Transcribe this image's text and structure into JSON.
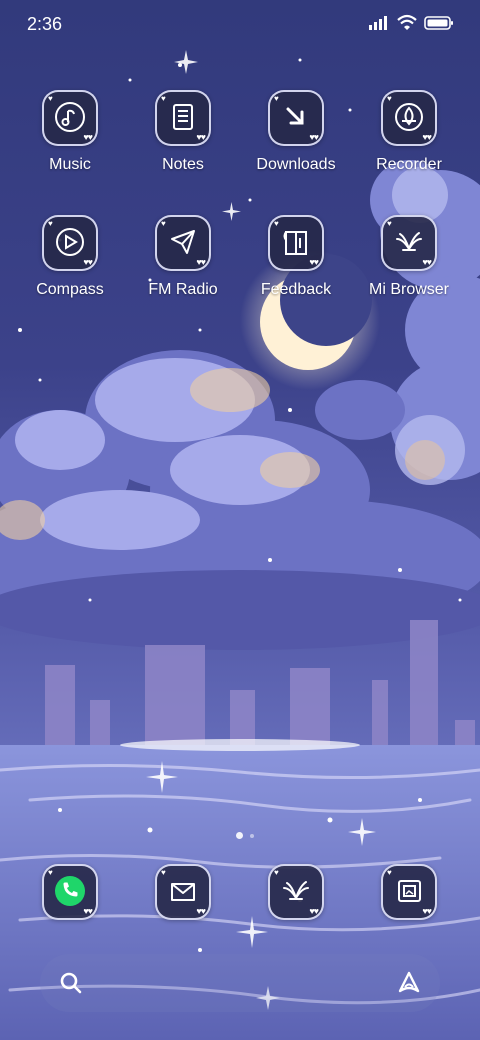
{
  "status_bar": {
    "time": "2:36"
  },
  "apps": [
    {
      "label": "Music"
    },
    {
      "label": "Notes"
    },
    {
      "label": "Downloads"
    },
    {
      "label": "Recorder"
    },
    {
      "label": "Compass"
    },
    {
      "label": "FM Radio"
    },
    {
      "label": "Feedback"
    },
    {
      "label": "Mi Browser"
    }
  ],
  "dock": [
    {
      "icon": "phone-icon"
    },
    {
      "icon": "messages-icon"
    },
    {
      "icon": "browser-icon"
    },
    {
      "icon": "gallery-icon"
    }
  ],
  "search_bar": {
    "left_icon": "search-icon",
    "right_icon": "assistant-icon"
  },
  "colors": {
    "sky_top": "#3a3f86",
    "sky_mid": "#5a5fb0",
    "water": "#6a74c4",
    "tile_border": "#e6e8ff",
    "phone_green": "#1fd66a"
  }
}
